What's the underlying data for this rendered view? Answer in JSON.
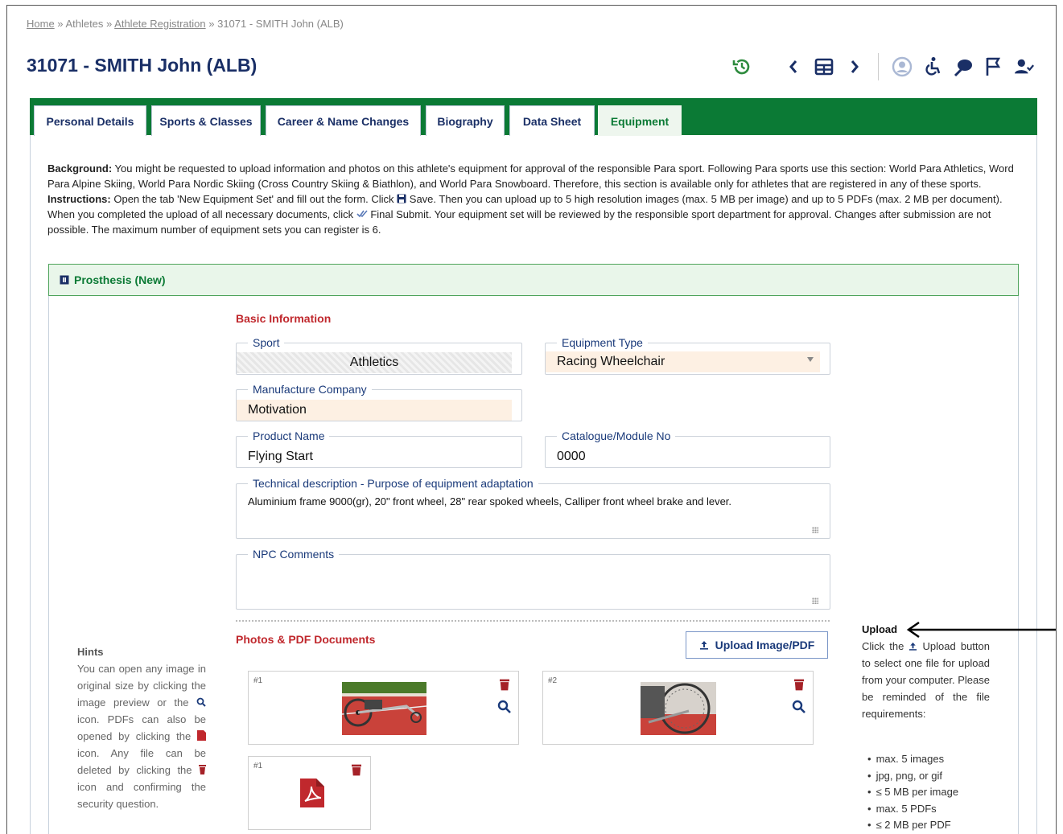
{
  "breadcrumb": {
    "home": "Home",
    "sep1": " » ",
    "athletes": "Athletes",
    "sep2": " » ",
    "registration": "Athlete Registration",
    "sep3": " » ",
    "current": "31071 - SMITH John (ALB)"
  },
  "page_title": "31071 - SMITH John (ALB)",
  "toolbar": {
    "icons": [
      "history-icon",
      "chevron-left-icon",
      "grid-icon",
      "chevron-right-icon",
      "user-circle-icon",
      "wheelchair-icon",
      "sport-icon",
      "flag-icon",
      "user-check-icon"
    ]
  },
  "tabs": [
    {
      "label": "Personal Details"
    },
    {
      "label": "Sports & Classes"
    },
    {
      "label": "Career & Name Changes"
    },
    {
      "label": "Biography"
    },
    {
      "label": "Data Sheet"
    },
    {
      "label": "Equipment"
    }
  ],
  "info": {
    "background_label": "Background:",
    "background_text": " You might be requested to upload information and photos on this athlete's equipment for approval of the responsible Para sport. Following Para sports use this section: World Para Athletics, Word Para Alpine Skiing, World Para Nordic Skiing (Cross Country Skiing & Biathlon), and World Para Snowboard. Therefore, this section is available only for athletes that are registered in any of these sports.",
    "instructions_label": "Instructions:",
    "instructions_a": " Open the tab 'New Equipment Set' and fill out the form. Click ",
    "save_word": " Save",
    "instructions_b": ". Then you can upload up to 5 high resolution images (max. 5 MB per image) and up to 5 PDFs (max. 2 MB per document). When you completed the upload of all necessary documents, click ",
    "final_submit": " Final Submit",
    "instructions_c": ". Your equipment set will be reviewed by the responsible sport department for approval. Changes after submission are not possible. The maximum number of equipment sets you can register is 6."
  },
  "panel": {
    "title": "Prosthesis (New)"
  },
  "basic_info": {
    "title": "Basic Information",
    "sport_label": "Sport",
    "sport_value": "Athletics",
    "equipment_type_label": "Equipment Type",
    "equipment_type_value": "Racing Wheelchair",
    "manufacturer_label": "Manufacture Company",
    "manufacturer_value": "Motivation",
    "product_label": "Product Name",
    "product_value": "Flying Start",
    "catalogue_label": "Catalogue/Module No",
    "catalogue_value": "0000",
    "tech_label": "Technical description - Purpose of equipment adaptation",
    "tech_value": "Aluminium frame 9000(gr), 20\" front wheel, 28\" rear spoked wheels, Calliper front wheel brake and lever.",
    "npc_label": "NPC Comments",
    "npc_value": ""
  },
  "photos": {
    "title": "Photos & PDF Documents",
    "upload_label": "Upload Image/PDF",
    "files": [
      {
        "num": "#1"
      },
      {
        "num": "#2"
      },
      {
        "num": "#1"
      }
    ]
  },
  "hints": {
    "title": "Hints",
    "text_a": "You can open any image in original size by clicking the image preview or the ",
    "text_b": " icon. PDFs can also be opened by clicking the ",
    "text_c": " icon. Any file can be deleted by clicking the ",
    "text_d": " icon and confirming the security question."
  },
  "upload_help": {
    "title": "Upload",
    "text_a": "Click the ",
    "text_b": " Upload button to select one file for upload from your computer. Please be reminded of the file requirements:",
    "requirements": [
      "max. 5 images",
      "jpg, png, or gif",
      "≤ 5 MB per image",
      "max. 5 PDFs",
      "≤ 2 MB per PDF"
    ]
  },
  "colors": {
    "tabbar": "#0b7a35",
    "title": "#1a2f66",
    "section_red": "#c0282d",
    "panel_green": "#e9f6ea"
  }
}
